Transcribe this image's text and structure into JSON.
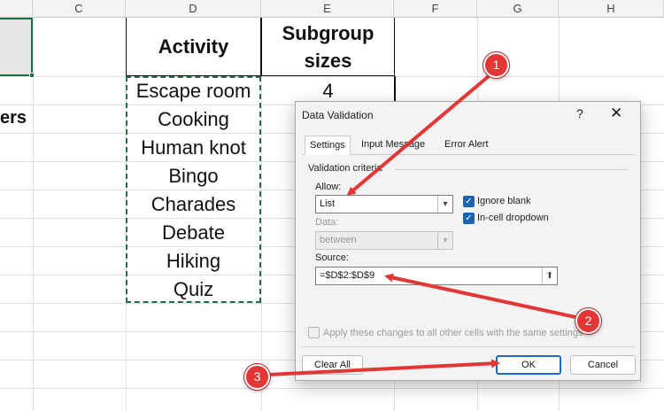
{
  "spreadsheet": {
    "column_headers": [
      "C",
      "D",
      "E",
      "F",
      "G",
      "H"
    ],
    "fragment_left_text": "ers",
    "table_headers": {
      "activity": "Activity",
      "subgroup_line1": "Subgroup",
      "subgroup_line2": "sizes"
    },
    "activities": [
      "Escape room",
      "Cooking",
      "Human knot",
      "Bingo",
      "Charades",
      "Debate",
      "Hiking",
      "Quiz"
    ],
    "subgroup_first_value": "4"
  },
  "dialog": {
    "title": "Data Validation",
    "help_glyph": "?",
    "close_glyph": "✕",
    "tabs": [
      "Settings",
      "Input Message",
      "Error Alert"
    ],
    "section_label": "Validation criteria",
    "allow_label": "Allow:",
    "allow_value": "List",
    "data_label": "Data:",
    "data_value": "between",
    "ignore_blank_label": "Ignore blank",
    "in_cell_dropdown_label": "In-cell dropdown",
    "source_label": "Source:",
    "source_value": "=$D$2:$D$9",
    "source_button_glyph": "⬆",
    "apply_all_label": "Apply these changes to all other cells with the same settings",
    "clear_all_label": "Clear All",
    "ok_label": "OK",
    "cancel_label": "Cancel"
  },
  "callouts": [
    "1",
    "2",
    "3"
  ],
  "colors": {
    "callout_red": "#e53636",
    "checkbox_blue": "#1a64b4",
    "selection_green": "#1e7145",
    "ok_border": "#1c6bc0"
  }
}
